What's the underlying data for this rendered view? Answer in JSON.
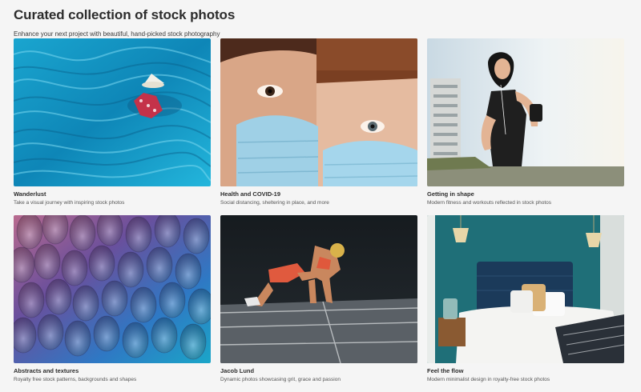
{
  "header": {
    "title": "Curated collection of stock photos",
    "subtitle": "Enhance your next project with beautiful, hand-picked stock photography"
  },
  "collections": [
    {
      "title": "Wanderlust",
      "description": "Take a visual journey with inspiring stock photos",
      "image": "woman-in-blue-fabric-photo"
    },
    {
      "title": "Health and COVID-19",
      "description": "Social distancing, sheltering in place, and more",
      "image": "children-wearing-masks-photo"
    },
    {
      "title": "Getting in shape",
      "description": "Modern fitness and workouts reflected in stock photos",
      "image": "woman-fitness-photo"
    },
    {
      "title": "Abstracts and textures",
      "description": "Royalty free stock patterns, backgrounds and shapes",
      "image": "feather-texture-photo"
    },
    {
      "title": "Jacob Lund",
      "description": "Dynamic photos showcasing grit, grace and passion",
      "image": "sprinter-start-photo"
    },
    {
      "title": "Feel the flow",
      "description": "Modern minimalist design in royalty-free stock photos",
      "image": "teal-bedroom-photo"
    }
  ],
  "colors": {
    "background": "#f5f5f5",
    "text": "#2c2c2c"
  }
}
